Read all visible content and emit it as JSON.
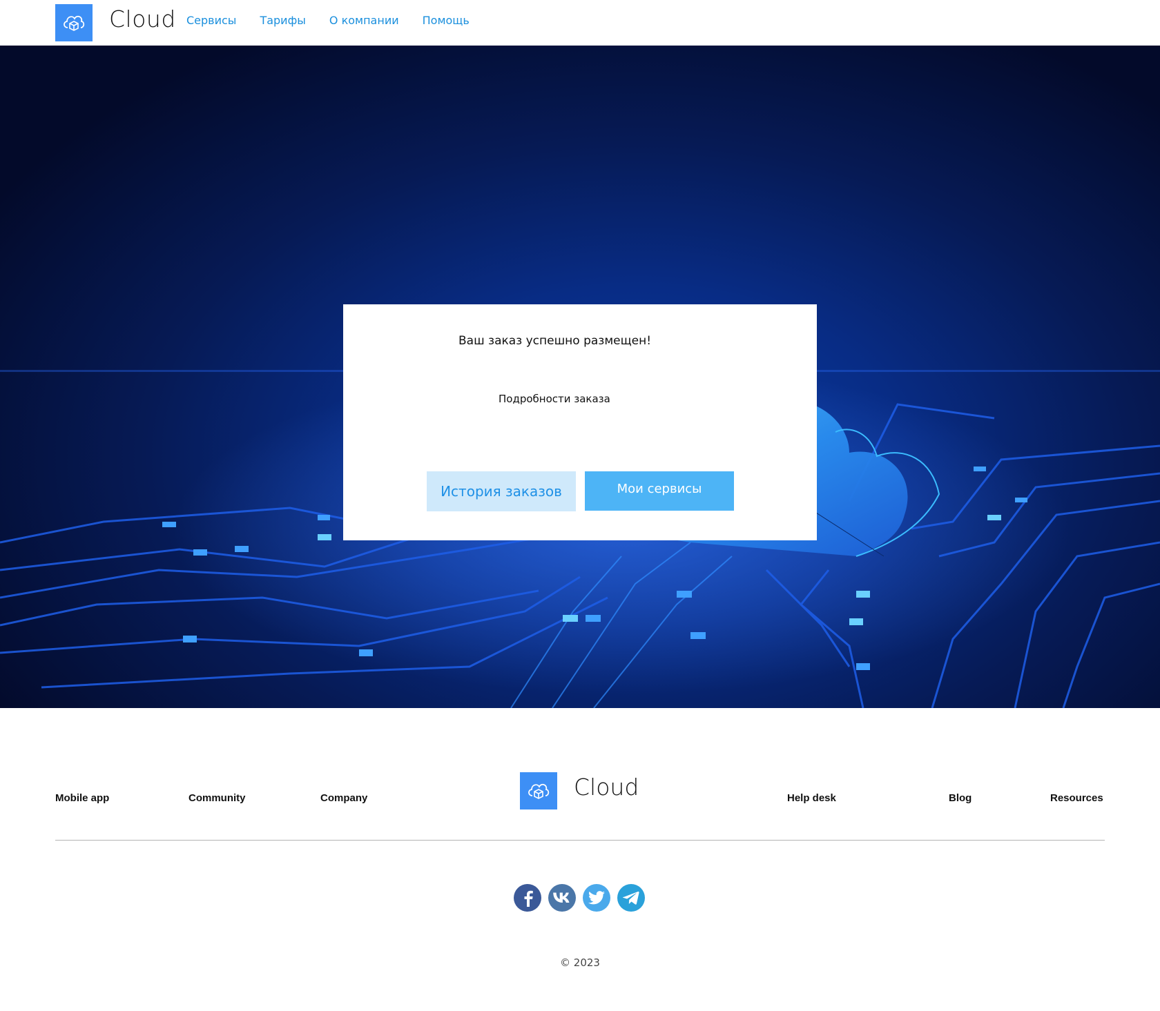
{
  "header": {
    "logo_text": "Cloud",
    "nav": [
      {
        "label": "Сервисы"
      },
      {
        "label": "Тарифы"
      },
      {
        "label": "О компании"
      },
      {
        "label": "Помощь"
      }
    ]
  },
  "modal": {
    "title": "Ваш заказ успешно размещен!",
    "details_link": "Подробности заказа",
    "history_button": "История заказов",
    "services_button": "Мои сервисы"
  },
  "footer": {
    "links_left": [
      "Mobile app",
      "Community",
      "Company"
    ],
    "links_right": [
      "Help desk",
      "Blog",
      "Resources"
    ],
    "logo_text": "Cloud",
    "socials": [
      {
        "name": "facebook-icon",
        "color": "#3b5998"
      },
      {
        "name": "vk-icon",
        "color": "#4a76a8"
      },
      {
        "name": "twitter-icon",
        "color": "#4aa9eb"
      },
      {
        "name": "telegram-icon",
        "color": "#2aa1da"
      }
    ],
    "copyright": "© 2023"
  },
  "colors": {
    "accent": "#3d8ff5",
    "nav_link": "#1a8fdd",
    "button_primary": "#4db4f6",
    "button_secondary": "#cfe9fb"
  }
}
